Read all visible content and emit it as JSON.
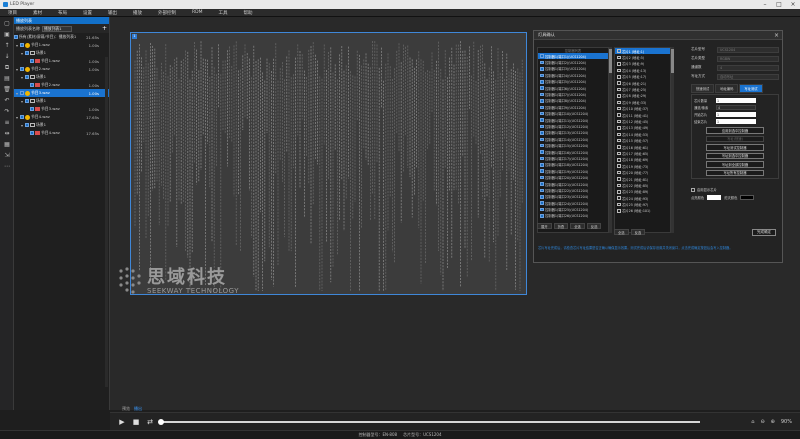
{
  "window": {
    "title": "LED Player"
  },
  "menu": [
    "项目",
    "素材",
    "布局",
    "设置",
    "输出",
    "播放",
    "外部控制",
    "RDM",
    "工具",
    "帮助"
  ],
  "sidebar_icons": [
    "new-icon",
    "save-icon",
    "up-icon",
    "down-icon",
    "copy-icon",
    "paste-icon",
    "delete-icon",
    "undo-icon",
    "redo-icon",
    "align-icon",
    "distribute-icon",
    "grid-icon",
    "export-icon",
    "more-icon"
  ],
  "panel": {
    "header": "播放列表",
    "toolbar_label": "播放列表名称",
    "toolbar_select": "播放列表1",
    "summary_label": "所有(素材/屏幕/节目)：播放列表1",
    "summary_value": "21.65s",
    "items": [
      {
        "label": "节目1.wav",
        "value": "1.00s",
        "level": 0,
        "kind": "program"
      },
      {
        "label": "场景1",
        "value": "",
        "level": 1,
        "kind": "scene"
      },
      {
        "label": "节目1.wav",
        "value": "1.00s",
        "level": 2,
        "kind": "media"
      },
      {
        "label": "节目2.wav",
        "value": "1.00s",
        "level": 0,
        "kind": "program"
      },
      {
        "label": "场景1",
        "value": "",
        "level": 1,
        "kind": "scene"
      },
      {
        "label": "节目2.wav",
        "value": "1.00s",
        "level": 2,
        "kind": "media"
      },
      {
        "label": "节目3.wav",
        "value": "1.00s",
        "level": 0,
        "kind": "program",
        "selected": true
      },
      {
        "label": "场景1",
        "value": "",
        "level": 1,
        "kind": "scene"
      },
      {
        "label": "节目3.wav",
        "value": "1.00s",
        "level": 2,
        "kind": "media"
      },
      {
        "label": "节目4.wav",
        "value": "17.65s",
        "level": 0,
        "kind": "program"
      },
      {
        "label": "场景1",
        "value": "",
        "level": 1,
        "kind": "scene"
      },
      {
        "label": "节目4.wav",
        "value": "17.65s",
        "level": 2,
        "kind": "media"
      }
    ]
  },
  "canvas": {
    "corner_label": "1"
  },
  "watermark": {
    "cn": "思域科技",
    "en": "SEEKWAY TECHNOLOGY"
  },
  "bottom_tabs": [
    {
      "label": "预览",
      "active": false
    },
    {
      "label": "播出",
      "active": true
    }
  ],
  "playbar": {
    "zoom": "90%"
  },
  "status": {
    "controller": "控制器型号：EN-808",
    "chip": "芯片型号：UCS1204"
  },
  "dialog": {
    "title": "灯具确认",
    "list_header": "控制器列表",
    "left_rows": [
      "控制器1(端口1)(UCS1204)",
      "控制器1(端口2)(UCS1204)",
      "控制器1(端口3)(UCS1204)",
      "控制器1(端口4)(UCS1204)",
      "控制器1(端口5)(UCS1204)",
      "控制器1(端口6)(UCS1204)",
      "控制器1(端口7)(UCS1204)",
      "控制器1(端口8)(UCS1204)",
      "控制器1(端口9)(UCS1204)",
      "控制器1(端口10)(UCS1204)",
      "控制器1(端口11)(UCS1204)",
      "控制器1(端口12)(UCS1204)",
      "控制器1(端口13)(UCS1204)",
      "控制器1(端口14)(UCS1204)",
      "控制器1(端口15)(UCS1204)",
      "控制器1(端口16)(UCS1204)",
      "控制器1(端口17)(UCS1204)",
      "控制器1(端口18)(UCS1204)",
      "控制器1(端口19)(UCS1204)",
      "控制器1(端口20)(UCS1204)",
      "控制器1(端口21)(UCS1204)",
      "控制器1(端口22)(UCS1204)",
      "控制器1(端口23)(UCS1204)",
      "控制器1(端口24)(UCS1204)",
      "控制器1(端口25)(UCS1204)",
      "控制器1(端口26)(UCS1204)"
    ],
    "right_rows": [
      "芯片1 (地址:1)",
      "芯片2 (地址:5)",
      "芯片3 (地址:9)",
      "芯片4 (地址:13)",
      "芯片5 (地址:17)",
      "芯片6 (地址:21)",
      "芯片7 (地址:25)",
      "芯片8 (地址:29)",
      "芯片9 (地址:33)",
      "芯片10 (地址:37)",
      "芯片11 (地址:41)",
      "芯片12 (地址:45)",
      "芯片13 (地址:49)",
      "芯片14 (地址:53)",
      "芯片15 (地址:57)",
      "芯片16 (地址:61)",
      "芯片17 (地址:65)",
      "芯片18 (地址:69)",
      "芯片19 (地址:73)",
      "芯片20 (地址:77)",
      "芯片21 (地址:81)",
      "芯片22 (地址:85)",
      "芯片23 (地址:89)",
      "芯片24 (地址:93)",
      "芯片25 (地址:97)",
      "芯片26 (地址:101)"
    ],
    "left_buttons": [
      "展开",
      "折叠",
      "全选",
      "反选"
    ],
    "right_buttons": [
      "全选",
      "反选"
    ],
    "props": [
      {
        "label": "芯片型号",
        "value": "UCS1204"
      },
      {
        "label": "芯片类型",
        "value": "RGBW"
      },
      {
        "label": "通道数",
        "value": "4"
      },
      {
        "label": "写址方式",
        "value": "自动写址"
      }
    ],
    "tabs": [
      {
        "label": "快速测试",
        "active": false
      },
      {
        "label": "地址编码",
        "active": false
      },
      {
        "label": "写址测试",
        "active": true
      }
    ],
    "fields": [
      {
        "label": "芯片数量",
        "value": "1"
      },
      {
        "label": "通道/像素",
        "value": "4"
      },
      {
        "label": "开始芯片",
        "value": "1"
      },
      {
        "label": "结束芯片",
        "value": "1"
      }
    ],
    "buttons": [
      "应用到选中控制器",
      "写址(快速)",
      "写址测试控制器",
      "写址到选中控制器",
      "写址到全部控制器",
      "写址所有控制器"
    ],
    "checkbox_label": "启用显示芯片",
    "color_label": "点亮颜色",
    "color_label2": "熄灭颜色",
    "ok_label": "完成确定",
    "hint": "芯片写址完成后，请检查芯片写址结果是否正确以确保显示效果。测试完成后请保存设置并关闭窗口，点击完成确定按钮后会写入控制器。"
  },
  "colors": {
    "accent": "#1a73d0",
    "canvas_border": "#3f87d8"
  }
}
